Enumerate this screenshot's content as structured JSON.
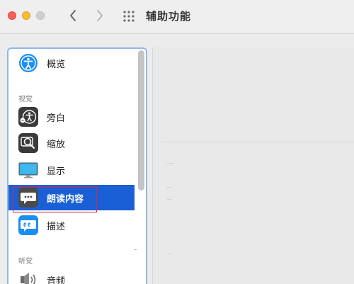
{
  "window": {
    "title": "辅助功能"
  },
  "sidebar": {
    "items": [
      {
        "label": "概览",
        "icon": "accessibility-icon"
      },
      {
        "label": "旁白",
        "icon": "voiceover-icon"
      },
      {
        "label": "缩放",
        "icon": "zoom-icon"
      },
      {
        "label": "显示",
        "icon": "display-icon"
      },
      {
        "label": "朗读内容",
        "icon": "speech-bubble-icon",
        "selected": true
      },
      {
        "label": "描述",
        "icon": "description-bubble-icon"
      },
      {
        "label": "音频",
        "icon": "speaker-icon"
      }
    ],
    "sections": {
      "vision": "视觉",
      "hearing": "听觉"
    }
  },
  "colors": {
    "selected": "#1a5fd6",
    "accent": "#1b8ef2",
    "focus_outline": "#d8263d"
  }
}
